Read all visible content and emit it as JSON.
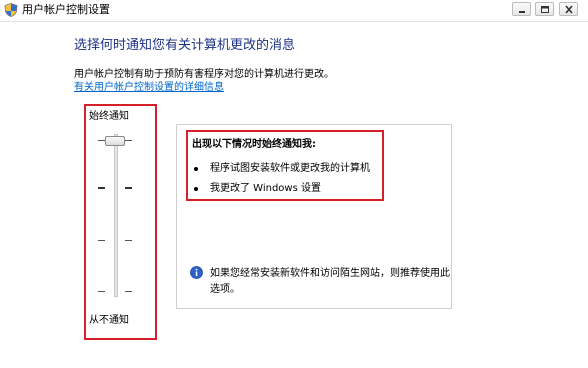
{
  "window": {
    "title": "用户帐户控制设置"
  },
  "main": {
    "heading": "选择何时通知您有关计算机更改的消息",
    "description": "用户帐户控制有助于预防有害程序对您的计算机进行更改。",
    "link": "有关用户帐户控制设置的详细信息"
  },
  "slider": {
    "top_label": "始终通知",
    "bottom_label": "从不通知",
    "level": "始终通知",
    "position": 0,
    "levels_count": 4
  },
  "panel": {
    "title": "出现以下情况时始终通知我:",
    "items": [
      "程序试图安装软件或更改我的计算机",
      "我更改了 Windows 设置"
    ],
    "note": "如果您经常安装新软件和访问陌生网站，则推荐使用此选项。"
  },
  "colors": {
    "heading": "#1e3287",
    "link": "#0066cc",
    "highlight_border": "#d4202a"
  },
  "icons": [
    "uac-shield-icon",
    "minimize-icon",
    "maximize-icon",
    "close-icon",
    "info-icon"
  ]
}
